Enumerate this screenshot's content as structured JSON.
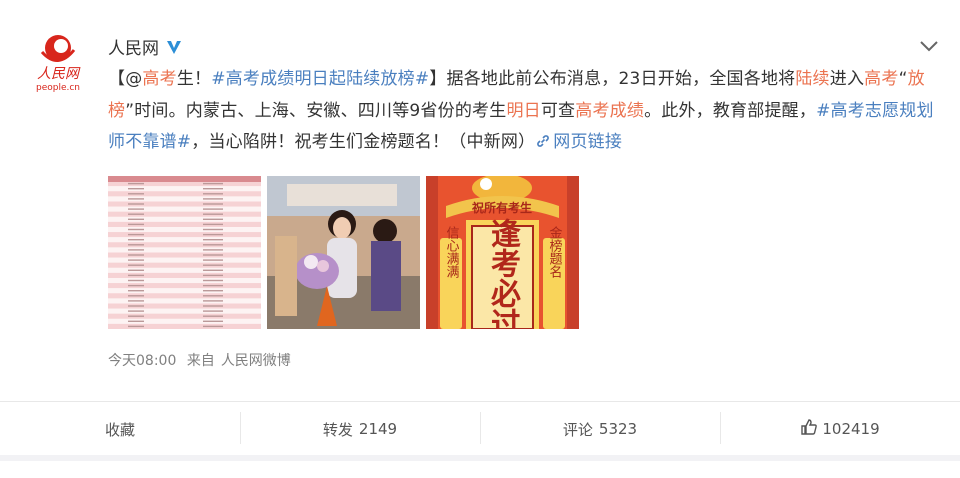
{
  "post": {
    "author": "人民网",
    "avatar_text": "people.cn",
    "text": {
      "p1": "【@",
      "p2": "高考",
      "p3": "生！",
      "p4": "#高考成绩明日起陆续放榜#",
      "p5": "】据各地此前公布消息，23日开始，全国各地将",
      "p6": "陆续",
      "p7": "进入",
      "p8": "高考",
      "p9": "“",
      "p10": "放榜",
      "p11": "”时间。内蒙古、上海、安徽、四川等9省份的考生",
      "p12": "明日",
      "p13": "可查",
      "p14": "高考成绩",
      "p15": "。此外，教育部提醒，",
      "p16": "#高考志愿规划师不靠谱#",
      "p17": "，当心陷阱！祝考生们金榜题名！（中新网）",
      "p18": "网页链接"
    },
    "poster_text": {
      "banner": "祝所有考生",
      "main": "逢考必过",
      "left": "信心满满",
      "right": "金榜题名"
    },
    "time": "今天08:00",
    "source_prefix": "来自",
    "source": "人民网微博"
  },
  "actions": {
    "favorite": "收藏",
    "repost_label": "转发",
    "repost_count": "2149",
    "comment_label": "评论",
    "comment_count": "5323",
    "like_count": "102419"
  },
  "colors": {
    "highlight": "#eb7350",
    "link": "#4a7fbf",
    "verified": "#2c8ed6"
  }
}
